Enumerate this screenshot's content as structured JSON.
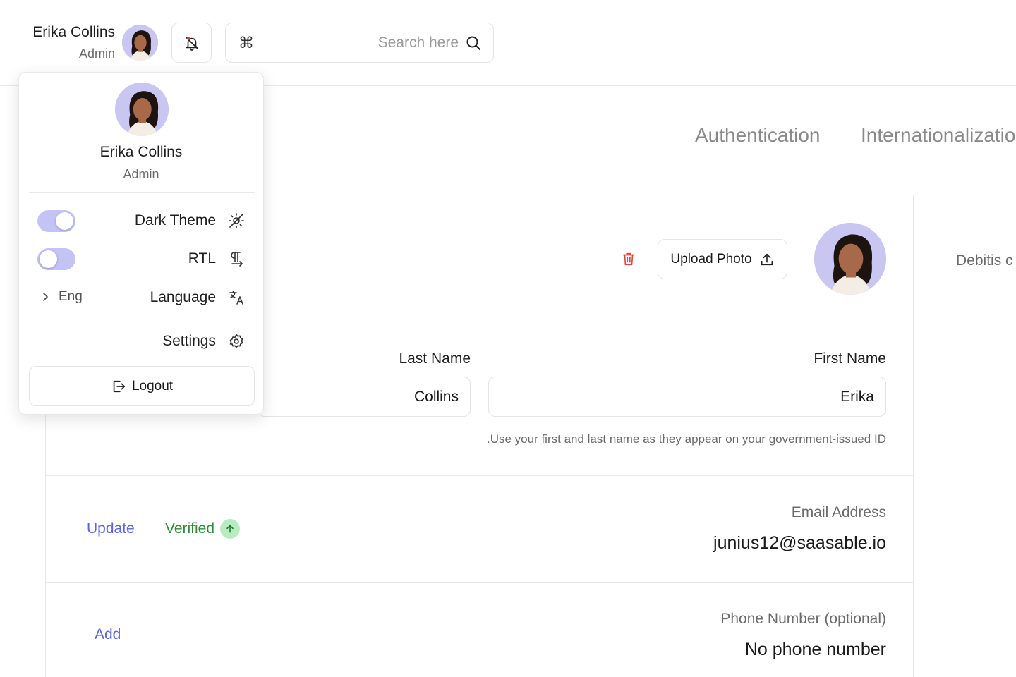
{
  "header": {
    "user_name": "Erika Collins",
    "user_role": "Admin",
    "search_placeholder": "Search here",
    "shortcut_glyph": "⌘"
  },
  "tabs": [
    {
      "label": "Authentication"
    },
    {
      "label": "Internationalization"
    }
  ],
  "profile": {
    "upload_label": "Upload Photo",
    "last_name_label": "Last Name",
    "first_name_label": "First Name",
    "last_name_value": "Collins",
    "first_name_value": "Erika",
    "name_hint": ".Use your first and last name as they appear on your government-issued ID",
    "email": {
      "label": "Email Address",
      "value": "junius12@saasable.io",
      "update_label": "Update",
      "status_label": "Verified"
    },
    "phone": {
      "label": "Phone Number (optional)",
      "value": "No phone number",
      "add_label": "Add"
    }
  },
  "side_panel": {
    "text": "Debitis c"
  },
  "dropdown": {
    "name": "Erika Collins",
    "role": "Admin",
    "dark_theme_label": "Dark Theme",
    "dark_theme_on": true,
    "rtl_label": "RTL",
    "rtl_on": false,
    "language_label": "Language",
    "language_value": "Eng",
    "settings_label": "Settings",
    "logout_label": "Logout"
  },
  "colors": {
    "accent": "#5b64d8",
    "toggle_track": "#c3c4f5",
    "avatar_bg": "#c9c7f2",
    "success": "#2e8b3a",
    "success_bg": "#b8ecc0",
    "danger": "#e0443a"
  },
  "icons": {
    "bell": "bell-notification-icon",
    "search": "search-icon",
    "command": "command-icon",
    "trash": "trash-icon",
    "upload": "upload-icon",
    "verified": "arrow-up-circle-icon",
    "dark_theme": "sun-off-icon",
    "rtl": "text-direction-icon",
    "language": "language-icon",
    "settings": "gear-icon",
    "logout": "logout-icon",
    "chevron": "chevron-right-icon"
  }
}
